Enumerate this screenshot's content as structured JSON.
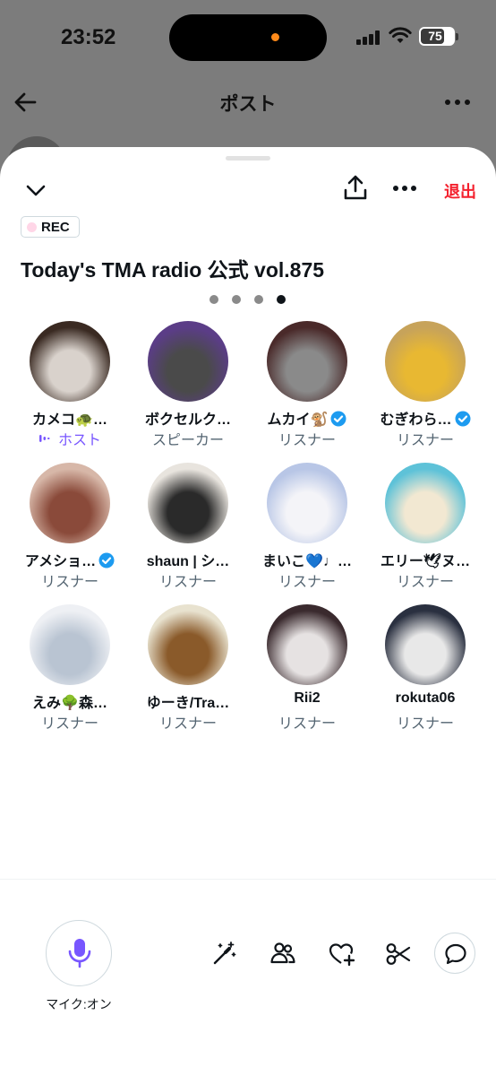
{
  "status_bar": {
    "time": "23:52",
    "battery": "75"
  },
  "nav": {
    "title": "ポスト"
  },
  "space": {
    "rec_label": "REC",
    "title": "Today's TMA radio 公式 vol.875",
    "leave_label": "退出",
    "page_count": 4,
    "active_page": 4
  },
  "participants": [
    {
      "name": "カメコ🐢…",
      "role": "ホスト",
      "verified": false,
      "colors": [
        "#3a2a22",
        "#d9d2cc"
      ]
    },
    {
      "name": "ボクセルク…",
      "role": "スピーカー",
      "verified": false,
      "colors": [
        "#5b3d87",
        "#4a4a4a"
      ]
    },
    {
      "name": "ムカイ🐒",
      "role": "リスナー",
      "verified": true,
      "colors": [
        "#4a2a2a",
        "#8a8a8a"
      ]
    },
    {
      "name": "むぎわら…",
      "role": "リスナー",
      "verified": true,
      "colors": [
        "#c7a35a",
        "#e8b832"
      ]
    },
    {
      "name": "アメショ…",
      "role": "リスナー",
      "verified": true,
      "colors": [
        "#d7b7a8",
        "#8a4a3a"
      ]
    },
    {
      "name": "shaun | シ…",
      "role": "リスナー",
      "verified": false,
      "colors": [
        "#e8e4de",
        "#2a2a2a"
      ]
    },
    {
      "name": "まいこ💙♩…",
      "role": "リスナー",
      "verified": false,
      "colors": [
        "#b8c6e6",
        "#f4f4f8"
      ]
    },
    {
      "name": "エリー🕊ヌ…",
      "role": "リスナー",
      "verified": false,
      "colors": [
        "#5ec2d8",
        "#f2e8d2"
      ]
    },
    {
      "name": "えみ🌳森…",
      "role": "リスナー",
      "verified": false,
      "colors": [
        "#eef0f4",
        "#b9c4d2"
      ]
    },
    {
      "name": "ゆーき/Tra…",
      "role": "リスナー",
      "verified": false,
      "colors": [
        "#e8e2cf",
        "#8a5a2a"
      ]
    },
    {
      "name": "Rii2",
      "role": "リスナー",
      "verified": false,
      "colors": [
        "#3a2a2e",
        "#e6e2e2"
      ]
    },
    {
      "name": "rokuta06",
      "role": "リスナー",
      "verified": false,
      "colors": [
        "#2a3040",
        "#e8e8e8"
      ]
    }
  ],
  "bottom_bar": {
    "mic_label": "マイク:オン"
  },
  "colors": {
    "accent": "#7856ff",
    "leave": "#f4212e",
    "verified": "#1d9bf0"
  }
}
